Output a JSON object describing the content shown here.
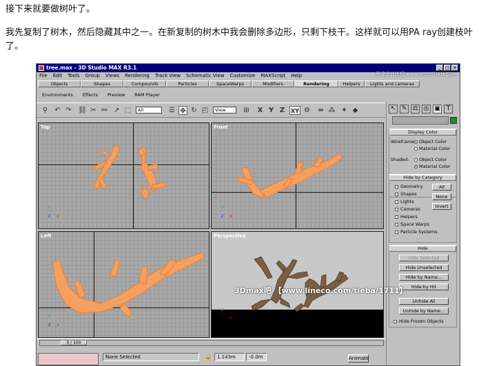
{
  "article": {
    "para1": "接下来就要做树叶了。",
    "para2": "我先复制了树木，然后隐藏其中之一。在新复制的树木中我会删除多边形，只剩下枝干。这样就可以用PA ray创建枝叶了。"
  },
  "window": {
    "title": "tree.max - 3D Studio MAX R3.1",
    "watermark_top": "思缘设计论坛 www.MISSYUAN.COM",
    "watermark_bottom": "3Dmax吧 【www.lineco.com/tieba/1711】"
  },
  "menu": [
    "File",
    "Edit",
    "Tools",
    "Group",
    "Views",
    "Rendering",
    "Track View",
    "Schematic View",
    "Customize",
    "MAXScript",
    "Help"
  ],
  "tabs": [
    "Objects",
    "Shapes",
    "Compounds",
    "Particles",
    "SpaceWarps",
    "Modifiers",
    "Rendering",
    "Helpers",
    "Lights and cameras"
  ],
  "active_tab": "Rendering",
  "subtabs": [
    "Environments",
    "Effects",
    "Preview",
    "RAM Player"
  ],
  "toolbar": {
    "selection_filter": "All",
    "ref_coord": "View",
    "axis_x": "X",
    "axis_y": "Y",
    "axis_z": "Z",
    "axis_xy": "XY"
  },
  "viewports": {
    "top": "Top",
    "front": "Front",
    "left": "Left",
    "perspective": "Perspective"
  },
  "axes": {
    "x": "x",
    "y": "y",
    "z": "z"
  },
  "command_panel": {
    "display_color": {
      "title": "Display Color",
      "wireframe_label": "Wireframe:",
      "shaded_label": "Shaded:",
      "object_color": "Object Color",
      "material_color": "Material Color",
      "wireframe_selected": "Object Color",
      "shaded_selected": "Material Color"
    },
    "hide_by_category": {
      "title": "Hide by Category",
      "items": [
        "Geometry",
        "Shapes",
        "Lights",
        "Cameras",
        "Helpers",
        "Space Warps",
        "Particle Systems"
      ],
      "all": "All",
      "none": "None",
      "invert": "Invert"
    },
    "hide": {
      "title": "Hide",
      "hide_selected": "Hide Selected",
      "hide_unselected": "Hide Unselected",
      "hide_by_name": "Hide by Name...",
      "hide_by_hit": "Hide by Hit",
      "unhide_all": "Unhide All",
      "unhide_by_name": "Unhide by Name...",
      "hide_frozen": "Hide Frozen Objects"
    }
  },
  "status": {
    "frame": "0 / 100",
    "selection": "None Selected",
    "x_value": "1.143m",
    "y_value": "-0.0m",
    "animate": "Animate"
  },
  "colors": {
    "titlebar": "#00007b",
    "viewport_grid": "#a9a9a9",
    "wireframe": "#f4a060",
    "mesh_brown": "#7a5f45"
  }
}
